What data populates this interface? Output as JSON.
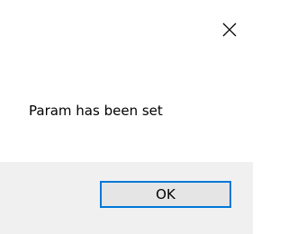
{
  "dialog": {
    "message": "Param has been set",
    "ok_label": "OK",
    "close_icon": "close-icon"
  },
  "colors": {
    "background": "#ffffff",
    "footer": "#f0f0f0",
    "button_border": "#0078d7",
    "button_bg": "#e5e5e5",
    "text": "#000000"
  }
}
